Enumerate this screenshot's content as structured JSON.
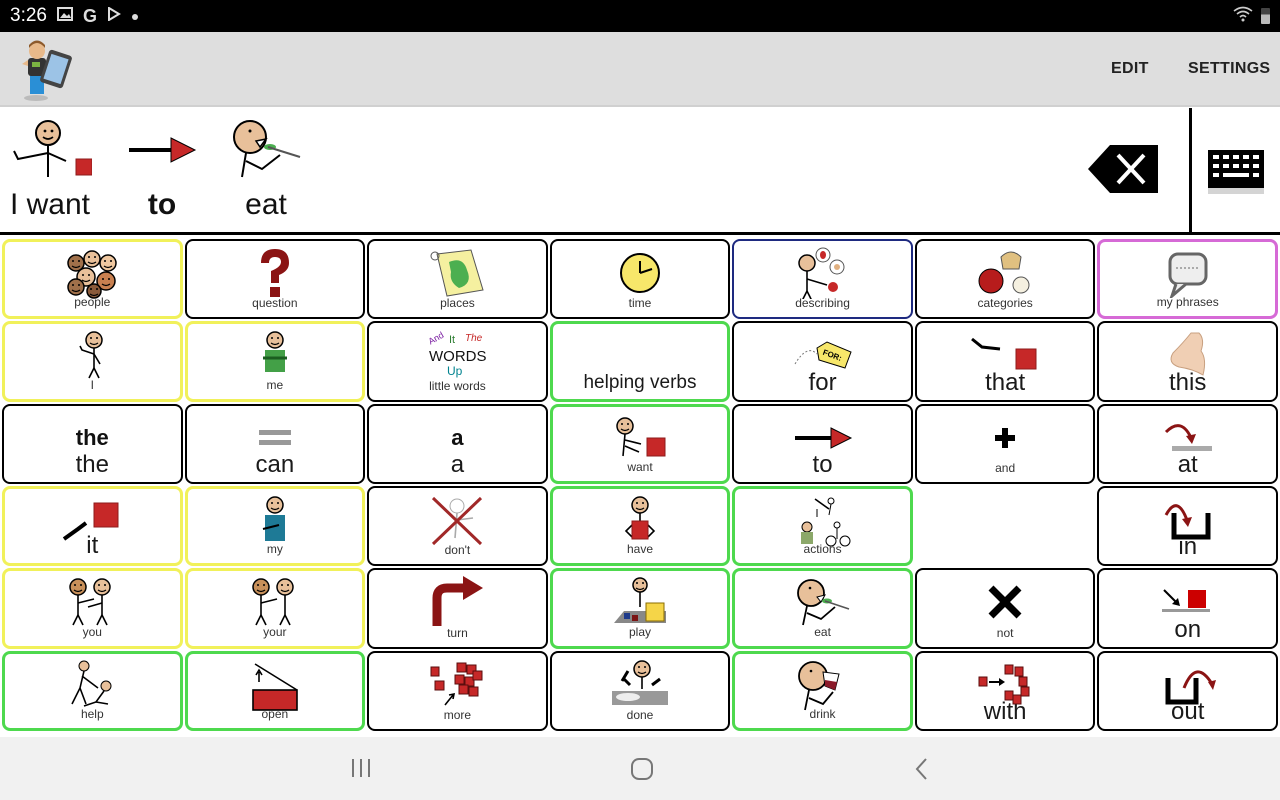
{
  "status_bar": {
    "time": "3:26",
    "left_icons": [
      "gallery-icon",
      "google-icon",
      "play-store-icon",
      "dot-icon"
    ],
    "right_icons": [
      "wifi-icon",
      "battery-icon"
    ]
  },
  "app_bar": {
    "logo": "boy-with-tablet-logo",
    "edit_label": "EDIT",
    "settings_label": "SETTINGS"
  },
  "sentence": {
    "words": [
      {
        "label": "I want",
        "icon": "want-symbol",
        "bold": false
      },
      {
        "label": "to",
        "icon": "arrow-right-symbol",
        "bold": true
      },
      {
        "label": "eat",
        "icon": "eat-symbol",
        "bold": false
      }
    ],
    "backspace_icon": "backspace-icon",
    "keyboard_icon": "keyboard-icon"
  },
  "colors": {
    "yellow_border": "#f1f15a",
    "green_border": "#4ed94e",
    "navy_border": "#1e2a80",
    "magenta_border": "#d66ad6",
    "black_border": "#000000",
    "symbol_red": "#c62828"
  },
  "grid": {
    "rows": [
      [
        {
          "label": "people",
          "icon": "people",
          "border": "yellow",
          "size": "small"
        },
        {
          "label": "question",
          "icon": "question",
          "border": "black",
          "size": "small"
        },
        {
          "label": "places",
          "icon": "places",
          "border": "black",
          "size": "small"
        },
        {
          "label": "time",
          "icon": "time",
          "border": "black",
          "size": "small"
        },
        {
          "label": "describing",
          "icon": "describing",
          "border": "navy",
          "size": "small"
        },
        {
          "label": "categories",
          "icon": "categories",
          "border": "black",
          "size": "small"
        },
        {
          "label": "my phrases",
          "icon": "speech-bubble",
          "border": "magenta",
          "size": "small"
        }
      ],
      [
        {
          "label": "I",
          "icon": "i-person",
          "border": "yellow",
          "size": "small"
        },
        {
          "label": "me",
          "icon": "me-person",
          "border": "yellow",
          "size": "small"
        },
        {
          "label": "little words",
          "icon": "little-words",
          "border": "black",
          "size": "small"
        },
        {
          "label": "helping verbs",
          "icon": "",
          "border": "green",
          "size": "big-helping"
        },
        {
          "label": "for",
          "icon": "for-tag",
          "border": "black",
          "size": "big"
        },
        {
          "label": "that",
          "icon": "that-point",
          "border": "black",
          "size": "big"
        },
        {
          "label": "this",
          "icon": "this-hand",
          "border": "black",
          "size": "big"
        }
      ],
      [
        {
          "label": "the",
          "icon": "the-text",
          "icon_text": "the",
          "border": "black",
          "size": "big"
        },
        {
          "label": "can",
          "icon": "equals",
          "border": "black",
          "size": "big"
        },
        {
          "label": "a",
          "icon": "a-text",
          "icon_text": "a",
          "border": "black",
          "size": "big"
        },
        {
          "label": "want",
          "icon": "want",
          "border": "green",
          "size": "small"
        },
        {
          "label": "to",
          "icon": "arrow-right",
          "border": "black",
          "size": "big"
        },
        {
          "label": "and",
          "icon": "plus",
          "border": "black",
          "size": "small"
        },
        {
          "label": "at",
          "icon": "at-arc",
          "border": "black",
          "size": "big"
        }
      ],
      [
        {
          "label": "it",
          "icon": "it-point",
          "border": "yellow",
          "size": "big"
        },
        {
          "label": "my",
          "icon": "my-person",
          "border": "yellow",
          "size": "small"
        },
        {
          "label": "don't",
          "icon": "dont-cross",
          "border": "black",
          "size": "small"
        },
        {
          "label": "have",
          "icon": "have",
          "border": "green",
          "size": "small"
        },
        {
          "label": "actions",
          "icon": "actions",
          "border": "green",
          "size": "small"
        },
        {
          "label": "",
          "icon": "",
          "border": "empty",
          "size": "small"
        },
        {
          "label": "in",
          "icon": "in-container",
          "border": "black",
          "size": "big"
        }
      ],
      [
        {
          "label": "you",
          "icon": "you-people",
          "border": "yellow",
          "size": "small"
        },
        {
          "label": "your",
          "icon": "your-people",
          "border": "yellow",
          "size": "small"
        },
        {
          "label": "turn",
          "icon": "turn-arrow",
          "border": "black",
          "size": "small"
        },
        {
          "label": "play",
          "icon": "play",
          "border": "green",
          "size": "small"
        },
        {
          "label": "eat",
          "icon": "eat",
          "border": "green",
          "size": "small"
        },
        {
          "label": "not",
          "icon": "x-mark",
          "border": "black",
          "size": "small"
        },
        {
          "label": "on",
          "icon": "on-block",
          "border": "black",
          "size": "big"
        }
      ],
      [
        {
          "label": "help",
          "icon": "help",
          "border": "green",
          "size": "small"
        },
        {
          "label": "open",
          "icon": "open-box",
          "border": "green",
          "size": "small"
        },
        {
          "label": "more",
          "icon": "more-blocks",
          "border": "black",
          "size": "small"
        },
        {
          "label": "done",
          "icon": "done",
          "border": "black",
          "size": "small"
        },
        {
          "label": "drink",
          "icon": "drink",
          "border": "green",
          "size": "small"
        },
        {
          "label": "with",
          "icon": "with-blocks",
          "border": "black",
          "size": "big"
        },
        {
          "label": "out",
          "icon": "out-container",
          "border": "black",
          "size": "big"
        }
      ]
    ]
  },
  "nav_bar": {
    "recent_icon": "recent-apps-icon",
    "home_icon": "home-icon",
    "back_icon": "back-icon"
  }
}
